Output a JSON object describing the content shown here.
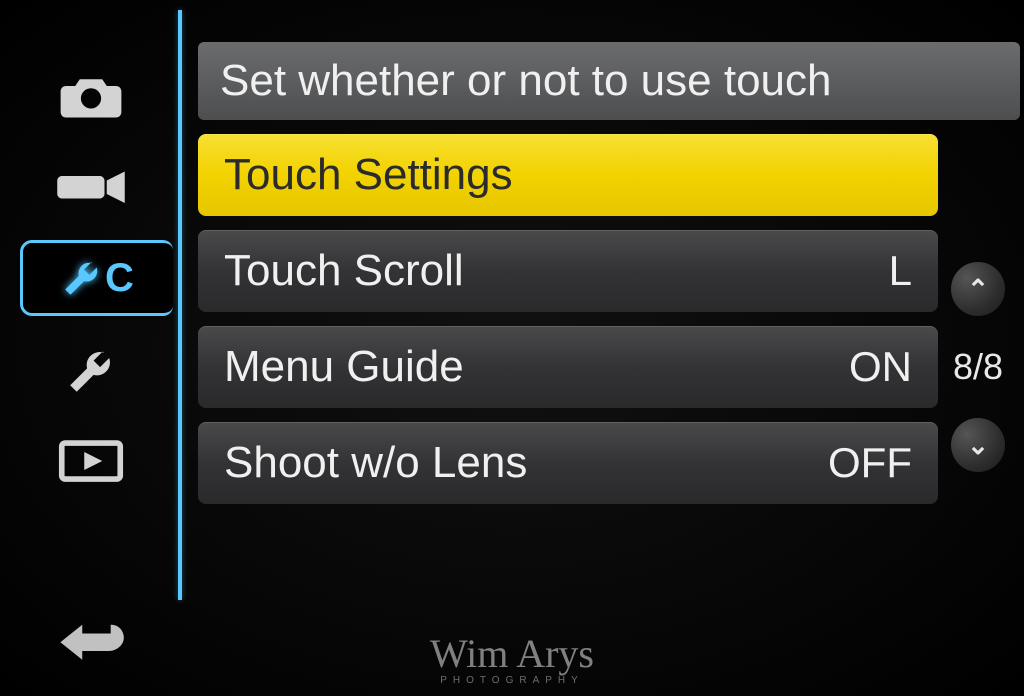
{
  "description": "Set whether or not to use touch",
  "selected_label": "Touch Settings",
  "rows": [
    {
      "label": "Touch Settings",
      "value": ""
    },
    {
      "label": "Touch Scroll",
      "value": "L"
    },
    {
      "label": "Menu Guide",
      "value": "ON"
    },
    {
      "label": "Shoot w/o Lens",
      "value": "OFF"
    }
  ],
  "page_indicator": "8/8",
  "tabs": {
    "camera": "camera-icon",
    "video": "video-icon",
    "custom": "wrench-c-icon",
    "setup": "wrench-icon",
    "play": "playback-icon"
  },
  "custom_tab_letter": "C",
  "watermark": {
    "name": "Wim Arys",
    "sub": "PHOTOGRAPHY"
  }
}
